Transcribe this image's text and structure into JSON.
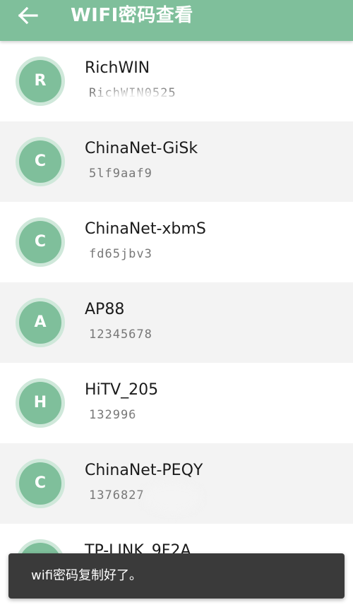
{
  "appbar": {
    "title": "WIFI密码查看",
    "back_icon": "arrow-left-icon",
    "color": "#7fbf9b"
  },
  "networks": [
    {
      "initial": "R",
      "ssid": "RichWIN",
      "password": "RichWIN0525"
    },
    {
      "initial": "C",
      "ssid": "ChinaNet-GiSk",
      "password": "5lf9aaf9"
    },
    {
      "initial": "C",
      "ssid": "ChinaNet-xbmS",
      "password": "fd65jbv3"
    },
    {
      "initial": "A",
      "ssid": "AP88",
      "password": "12345678"
    },
    {
      "initial": "H",
      "ssid": "HiTV_205",
      "password": "132996"
    },
    {
      "initial": "C",
      "ssid": "ChinaNet-PEQY",
      "password": "1376827"
    },
    {
      "initial": "T",
      "ssid": "TP-LINK_9F2A",
      "password": ""
    }
  ],
  "toast": {
    "message": "wifi密码复制好了。"
  }
}
